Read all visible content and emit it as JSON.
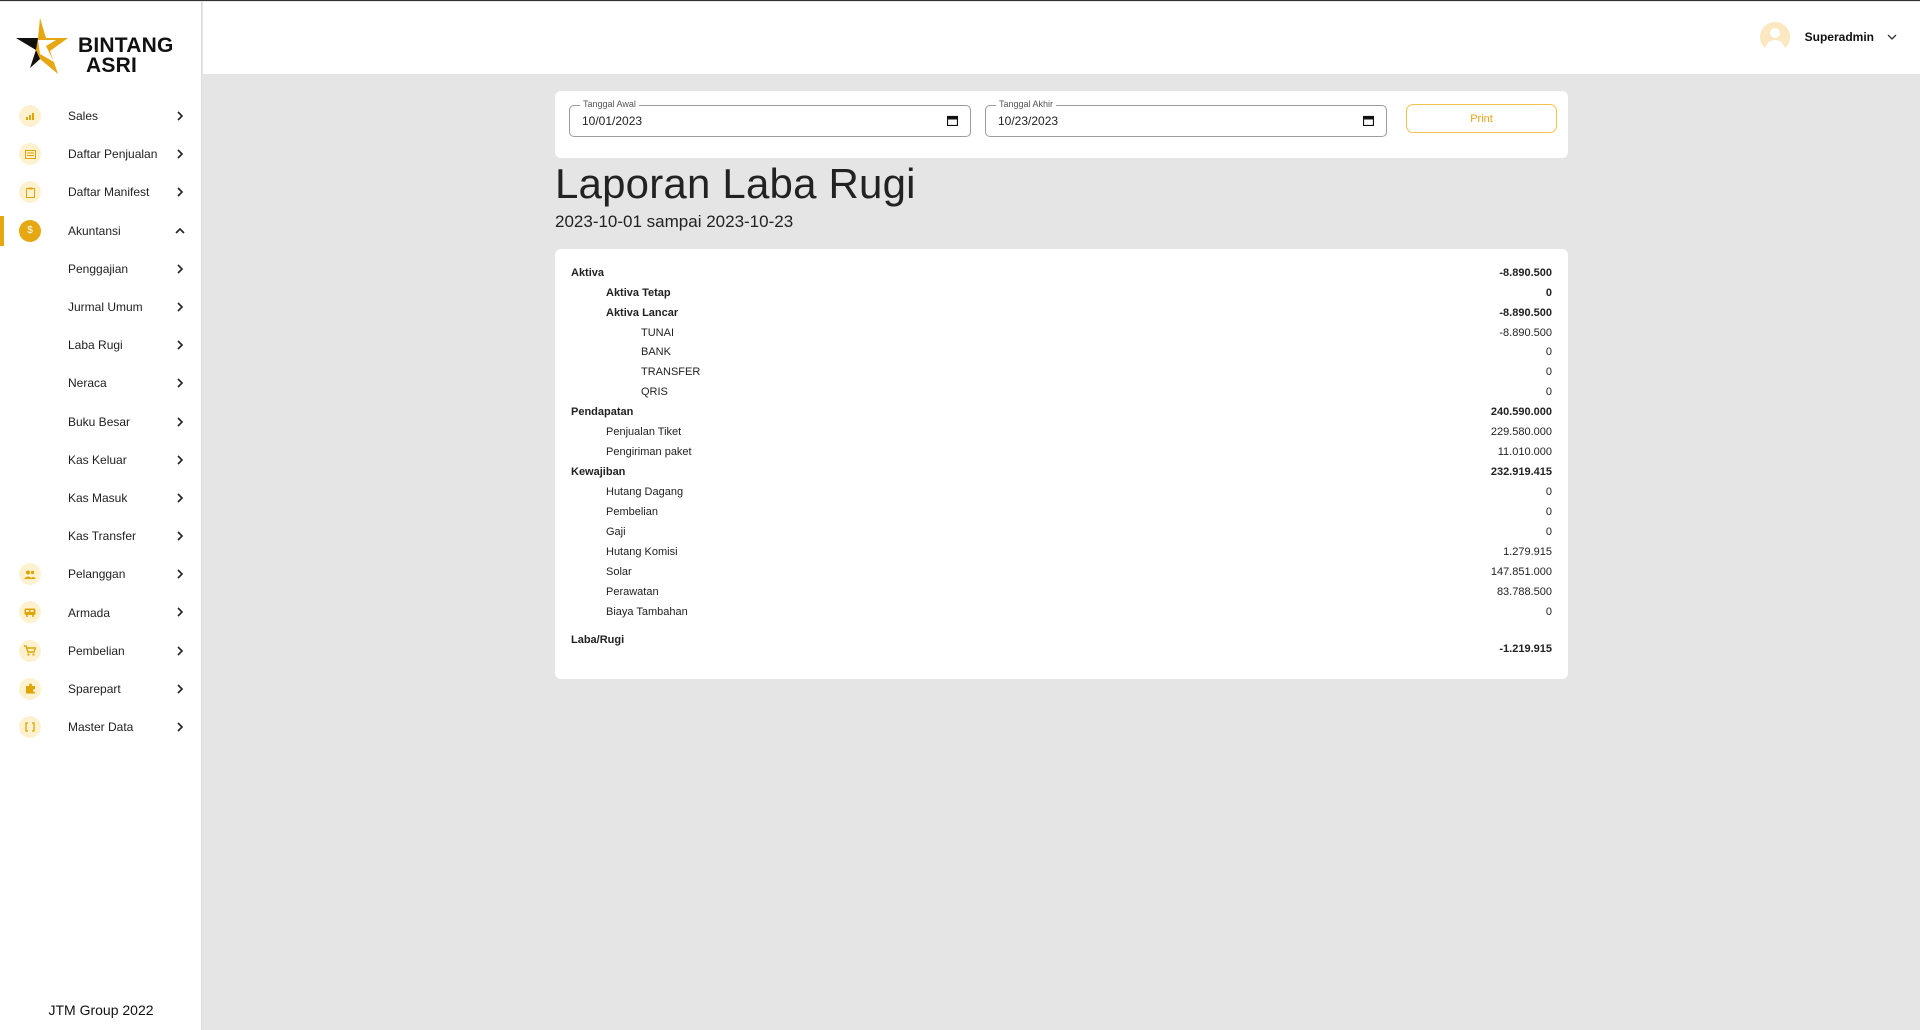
{
  "brand": {
    "line1": "BINTANG",
    "line2": "ASRI",
    "footer": "JTM Group 2022",
    "accent": "#e5a812"
  },
  "sidebar": {
    "items": [
      {
        "label": "Sales",
        "icon": "chart-icon"
      },
      {
        "label": "Daftar Penjualan",
        "icon": "receipt-icon"
      },
      {
        "label": "Daftar Manifest",
        "icon": "clipboard-icon"
      },
      {
        "label": "Akuntansi",
        "icon": "dollar-icon",
        "active": true,
        "expanded": true
      },
      {
        "label": "Penggajian"
      },
      {
        "label": "Jurmal Umum"
      },
      {
        "label": "Laba Rugi"
      },
      {
        "label": "Neraca"
      },
      {
        "label": "Buku Besar"
      },
      {
        "label": "Kas Keluar"
      },
      {
        "label": "Kas Masuk"
      },
      {
        "label": "Kas Transfer"
      },
      {
        "label": "Pelanggan",
        "icon": "users-icon"
      },
      {
        "label": "Armada",
        "icon": "bus-icon"
      },
      {
        "label": "Pembelian",
        "icon": "cart-icon"
      },
      {
        "label": "Sparepart",
        "icon": "puzzle-icon"
      },
      {
        "label": "Master Data",
        "icon": "brackets-icon"
      }
    ]
  },
  "header": {
    "user_name": "Superadmin"
  },
  "filter": {
    "start_label": "Tanggal Awal",
    "start_value": "10/01/2023",
    "end_label": "Tanggal Akhir",
    "end_value": "10/23/2023",
    "print_label": "Print"
  },
  "report": {
    "title": "Laporan Laba Rugi",
    "period": "2023-10-01 sampai 2023-10-23",
    "rows": [
      {
        "name": "Aktiva",
        "value": "-8.890.500"
      },
      {
        "name": "Aktiva Tetap",
        "value": "0"
      },
      {
        "name": "Aktiva Lancar",
        "value": "-8.890.500"
      },
      {
        "name": "TUNAI",
        "value": "-8.890.500"
      },
      {
        "name": "BANK",
        "value": "0"
      },
      {
        "name": "TRANSFER",
        "value": "0"
      },
      {
        "name": "QRIS",
        "value": "0"
      },
      {
        "name": "Pendapatan",
        "value": "240.590.000"
      },
      {
        "name": "Penjualan Tiket",
        "value": "229.580.000"
      },
      {
        "name": "Pengiriman paket",
        "value": "11.010.000"
      },
      {
        "name": "Kewajiban",
        "value": "232.919.415"
      },
      {
        "name": "Hutang Dagang",
        "value": "0"
      },
      {
        "name": "Pembelian",
        "value": "0"
      },
      {
        "name": "Gaji",
        "value": "0"
      },
      {
        "name": "Hutang Komisi",
        "value": "1.279.915"
      },
      {
        "name": "Solar",
        "value": "147.851.000"
      },
      {
        "name": "Perawatan",
        "value": "83.788.500"
      },
      {
        "name": "Biaya Tambahan",
        "value": "0"
      }
    ],
    "total_label": "Laba/Rugi",
    "total_value": "-1.219.915"
  }
}
